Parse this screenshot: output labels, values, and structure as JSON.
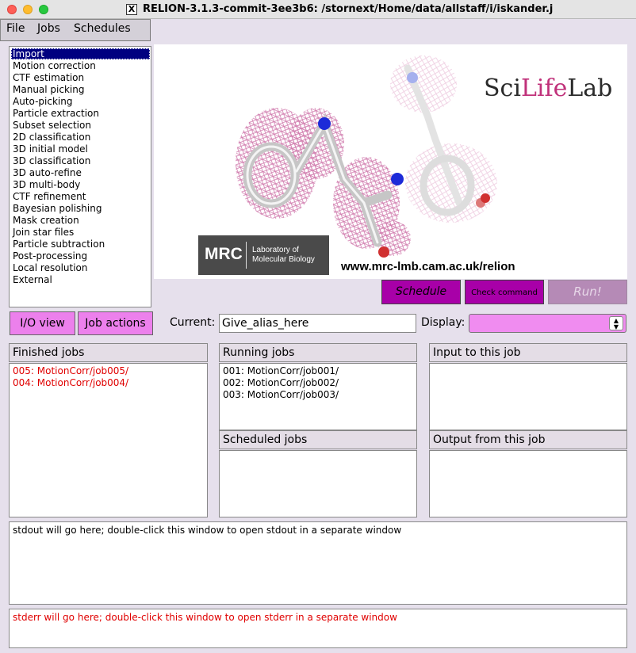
{
  "window": {
    "title": "RELION-3.1.3-commit-3ee3b6: /stornext/Home/data/allstaff/i/iskander.j",
    "x_logo": "X"
  },
  "menu": [
    "File",
    "Jobs",
    "Schedules"
  ],
  "job_types": [
    "Import",
    "Motion correction",
    "CTF estimation",
    "Manual picking",
    "Auto-picking",
    "Particle extraction",
    "Subset selection",
    "2D classification",
    "3D initial model",
    "3D classification",
    "3D auto-refine",
    "3D multi-body",
    "CTF refinement",
    "Bayesian polishing",
    "Mask creation",
    "Join star files",
    "Particle subtraction",
    "Post-processing",
    "Local resolution",
    "External"
  ],
  "selected_job_type": "Import",
  "banner": {
    "scilifelab_prefix": "Sci",
    "scilifelab_life": "Life",
    "scilifelab_suffix": "Lab",
    "mrc_abbrev": "MRC",
    "mrc_line1": "Laboratory of",
    "mrc_line2": "Molecular Biology",
    "url": "www.mrc-lmb.cam.ac.uk/relion"
  },
  "buttons": {
    "schedule": "Schedule",
    "check_command": "Check command",
    "run": "Run!",
    "io_view": "I/O view",
    "job_actions": "Job actions"
  },
  "current": {
    "label": "Current:",
    "value": "Give_alias_here"
  },
  "display": {
    "label": "Display:",
    "value": ""
  },
  "panels": {
    "finished": {
      "title": "Finished jobs",
      "items": [
        "005: MotionCorr/job005/",
        "004: MotionCorr/job004/"
      ]
    },
    "running": {
      "title": "Running jobs",
      "items": [
        "001: MotionCorr/job001/",
        "002: MotionCorr/job002/",
        "003: MotionCorr/job003/"
      ]
    },
    "input": {
      "title": "Input to this job"
    },
    "scheduled": {
      "title": "Scheduled jobs"
    },
    "output": {
      "title": "Output from this job"
    }
  },
  "stdout": "stdout will go here; double-click this window to open stdout in a separate window",
  "stderr": "stderr will go here; double-click this window to open stderr in a separate window",
  "colors": {
    "accent": "#a800a8",
    "button_pink": "#ec80ec",
    "selection": "#000080",
    "error_red": "#e00000"
  }
}
